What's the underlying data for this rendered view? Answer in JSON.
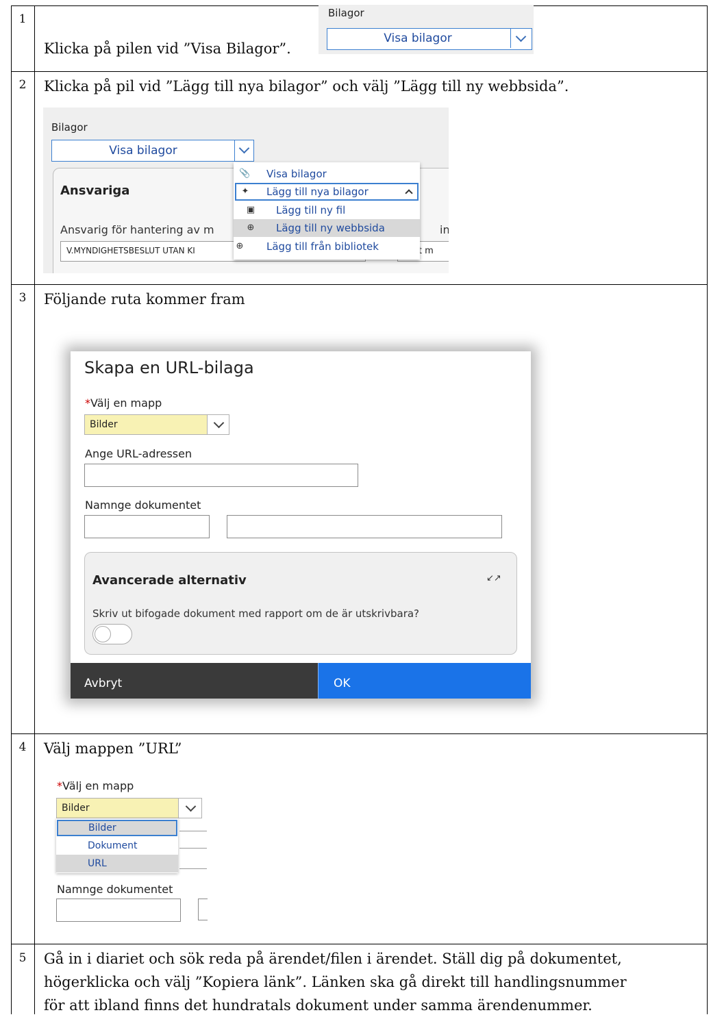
{
  "steps": [
    {
      "number": "1",
      "instruction": "Klicka på pilen vid ”Visa Bilagor”."
    },
    {
      "number": "2",
      "instruction": "Klicka på pil vid ”Lägg till nya bilagor” och välj ”Lägg till ny webbsida”."
    },
    {
      "number": "3",
      "instruction": "Följande ruta kommer fram"
    },
    {
      "number": "4",
      "instruction": "Välj mappen ”URL”"
    },
    {
      "number": "5",
      "instruction_lines": [
        "Gå in i diariet och sök reda på ärendet/filen i ärendet. Ställ dig på dokumentet,",
        "högerklicka och välj ”Kopiera länk”. Länken ska gå direkt till handlingsnummer",
        "för att ibland finns det hundratals dokument under samma ärendenummer."
      ]
    }
  ],
  "step1_shot": {
    "label": "Bilagor",
    "field_value": "Visa bilagor"
  },
  "step2_shot": {
    "label": "Bilagor",
    "field_value": "Visa bilagor",
    "card_title": "Ansvariga",
    "field_label": "Ansvarig för hantering av m",
    "field_label_suffix": "ing",
    "field_value_left": "V.MYNDIGHETSBESLUT UTAN KI",
    "field_value_right": "lut m",
    "menu": [
      {
        "label": "Visa bilagor",
        "icon": "paperclip-icon"
      },
      {
        "label": "Lägg till nya bilagor",
        "icon": "attachment-add-icon"
      },
      {
        "label": "Lägg till ny fil",
        "icon": "file-add-icon"
      },
      {
        "label": "Lägg till ny webbsida",
        "icon": "plus-circle-icon"
      },
      {
        "label": "Lägg till från bibliotek",
        "icon": "plus-circle-icon"
      }
    ]
  },
  "dialog": {
    "title": "Skapa en URL-bilaga",
    "required_mark": "*",
    "folder_label": "Välj en mapp",
    "folder_value": "Bilder",
    "url_label": "Ange URL-adressen",
    "url_value": "",
    "name_label": "Namnge dokumentet",
    "advanced_title": "Avancerade alternativ",
    "print_question": "Skriv ut bifogade dokument med rapport om de är utskrivbara?",
    "cancel_label": "Avbryt",
    "ok_label": "OK",
    "colors": {
      "cancel_bg": "#3a3a3a",
      "ok_bg": "#1a73e8",
      "folder_bg": "#f8f2b4"
    }
  },
  "step4_shot": {
    "required_mark": "*",
    "folder_label": "Välj en mapp",
    "folder_value": "Bilder",
    "options": [
      "Bilder",
      "Dokument",
      "URL"
    ],
    "name_label": "Namnge dokumentet"
  }
}
